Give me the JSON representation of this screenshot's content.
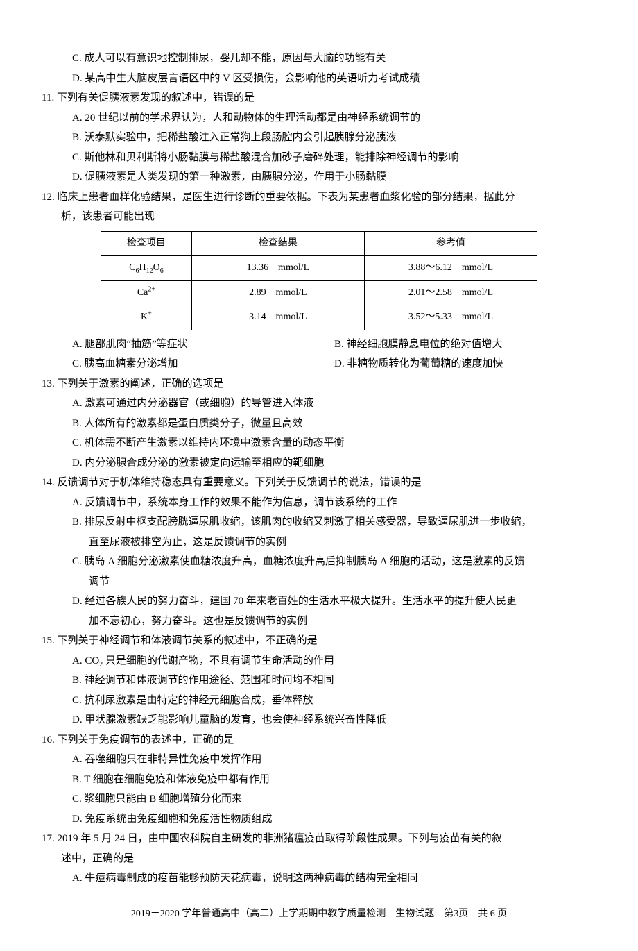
{
  "q10": {
    "optC": "C. 成人可以有意识地控制排尿，婴儿却不能，原因与大脑的功能有关",
    "optD": "D. 某高中生大脑皮层言语区中的 V 区受损伤，会影响他的英语听力考试成绩"
  },
  "q11": {
    "stem": "11. 下列有关促胰液素发现的叙述中，错误的是",
    "optA": "A. 20 世纪以前的学术界认为，人和动物体的生理活动都是由神经系统调节的",
    "optB": "B. 沃泰默实验中，把稀盐酸注入正常狗上段肠腔内会引起胰腺分泌胰液",
    "optC": "C. 斯他林和贝利斯将小肠黏膜与稀盐酸混合加砂子磨碎处理，能排除神经调节的影响",
    "optD": "D. 促胰液素是人类发现的第一种激素，由胰腺分泌，作用于小肠黏膜"
  },
  "q12": {
    "stem1": "12. 临床上患者血样化验结果，是医生进行诊断的重要依据。下表为某患者血浆化验的部分结果，据此分",
    "stem2": "析，该患者可能出现",
    "table": {
      "header": [
        "检查项目",
        "检查结果",
        "参考值"
      ],
      "rows": [
        {
          "item_html": "C<sub>6</sub>H<sub>12</sub>O<sub>6</sub>",
          "result": "13.36　mmol/L",
          "ref": "3.88～6.12　mmol/L"
        },
        {
          "item_html": "Ca<sup>2+</sup>",
          "result": "2.89　mmol/L",
          "ref": "2.01～2.58　mmol/L"
        },
        {
          "item_html": "K<sup>+</sup>",
          "result": "3.14　mmol/L",
          "ref": "3.52～5.33　mmol/L"
        }
      ]
    },
    "optA": "A. 腿部肌肉“抽筋”等症状",
    "optB": "B. 神经细胞膜静息电位的绝对值增大",
    "optC": "C. 胰高血糖素分泌增加",
    "optD": "D. 非糖物质转化为葡萄糖的速度加快"
  },
  "q13": {
    "stem": "13. 下列关于激素的阐述，正确的选项是",
    "optA": "A. 激素可通过内分泌器官（或细胞）的导管进入体液",
    "optB": "B. 人体所有的激素都是蛋白质类分子，微量且高效",
    "optC": "C. 机体需不断产生激素以维持内环境中激素含量的动态平衡",
    "optD": "D. 内分泌腺合成分泌的激素被定向运输至相应的靶细胞"
  },
  "q14": {
    "stem": "14. 反馈调节对于机体维持稳态具有重要意义。下列关于反馈调节的说法，错误的是",
    "optA": "A. 反馈调节中，系统本身工作的效果不能作为信息，调节该系统的工作",
    "optB1": "B. 排尿反射中枢支配膀胱逼尿肌收缩，该肌肉的收缩又刺激了相关感受器，导致逼尿肌进一步收缩，",
    "optB2": "直至尿液被排空为止，这是反馈调节的实例",
    "optC1": "C. 胰岛 A 细胞分泌激素使血糖浓度升高，血糖浓度升高后抑制胰岛 A 细胞的活动，这是激素的反馈",
    "optC2": "调节",
    "optD1": "D. 经过各族人民的努力奋斗，建国 70 年来老百姓的生活水平极大提升。生活水平的提升使人民更",
    "optD2": "加不忘初心，努力奋斗。这也是反馈调节的实例"
  },
  "q15": {
    "stem": "15. 下列关于神经调节和体液调节关系的叙述中，不正确的是",
    "optA_html": "A. CO<sub>2</sub> 只是细胞的代谢产物，不具有调节生命活动的作用",
    "optB": "B. 神经调节和体液调节的作用途径、范围和时间均不相同",
    "optC": "C. 抗利尿激素是由特定的神经元细胞合成，垂体释放",
    "optD": "D. 甲状腺激素缺乏能影响儿童脑的发育，也会使神经系统兴奋性降低"
  },
  "q16": {
    "stem": "16. 下列关于免疫调节的表述中，正确的是",
    "optA": "A. 吞噬细胞只在非特异性免疫中发挥作用",
    "optB": "B. T 细胞在细胞免疫和体液免疫中都有作用",
    "optC": "C. 浆细胞只能由 B 细胞增殖分化而来",
    "optD": "D. 免疫系统由免疫细胞和免疫活性物质组成"
  },
  "q17": {
    "stem1": "17. 2019 年 5 月 24 日，由中国农科院自主研发的非洲猪瘟疫苗取得阶段性成果。下列与疫苗有关的叙",
    "stem2": "述中，正确的是",
    "optA": "A. 牛痘病毒制成的疫苗能够预防天花病毒，说明这两种病毒的结构完全相同"
  },
  "footer": "2019－2020 学年普通高中（高二）上学期期中教学质量检测　生物试题　第3页　共 6 页"
}
